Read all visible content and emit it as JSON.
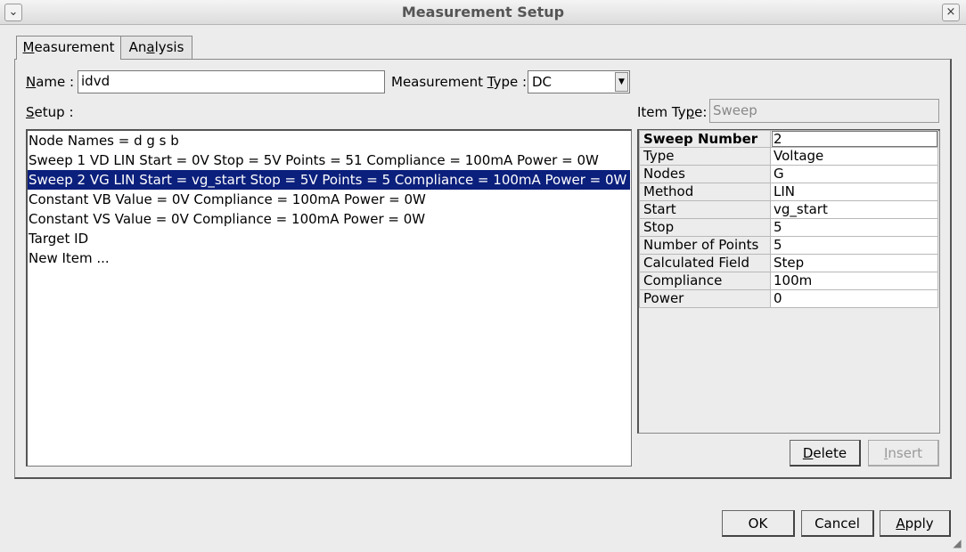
{
  "window": {
    "title": "Measurement Setup",
    "menu_glyph": "⌄",
    "close_glyph": "×"
  },
  "tabs": [
    {
      "label_u": "M",
      "label_rest": "easurement",
      "active": true
    },
    {
      "label_pre": "An",
      "label_u": "a",
      "label_rest": "lysis",
      "active": false
    }
  ],
  "form": {
    "name_label_u": "N",
    "name_label_rest": "ame :",
    "name_value": "idvd",
    "mtype_label_pre": "Measurement ",
    "mtype_label_u": "T",
    "mtype_label_rest": "ype :",
    "mtype_value": "DC",
    "setup_label_u": "S",
    "setup_label_rest": "etup :",
    "itemtype_label_pre": "Item Ty",
    "itemtype_label_u": "p",
    "itemtype_label_rest": "e:",
    "itemtype_value": "Sweep"
  },
  "setup_items": [
    "Node Names = d g s b",
    "Sweep 1 VD LIN Start = 0V Stop = 5V Points = 51 Compliance = 100mA Power = 0W",
    "Sweep 2 VG LIN Start = vg_start Stop = 5V Points = 5 Compliance = 100mA Power = 0W",
    "Constant VB Value = 0V Compliance = 100mA Power = 0W",
    "Constant VS Value = 0V Compliance = 100mA Power = 0W",
    "Target ID",
    "New Item ..."
  ],
  "selected_index": 2,
  "properties": [
    {
      "key": "Sweep Number",
      "value": "2"
    },
    {
      "key": "Type",
      "value": "Voltage"
    },
    {
      "key": "Nodes",
      "value": "G"
    },
    {
      "key": "Method",
      "value": "LIN"
    },
    {
      "key": "Start",
      "value": "vg_start"
    },
    {
      "key": "Stop",
      "value": "5"
    },
    {
      "key": "Number of Points",
      "value": "5"
    },
    {
      "key": "Calculated Field",
      "value": "Step"
    },
    {
      "key": "Compliance",
      "value": "100m"
    },
    {
      "key": "Power",
      "value": "0"
    }
  ],
  "buttons": {
    "delete_u": "D",
    "delete_rest": "elete",
    "insert_u": "I",
    "insert_rest": "nsert",
    "ok": "OK",
    "cancel": "Cancel",
    "apply_u": "A",
    "apply_rest": "pply"
  }
}
